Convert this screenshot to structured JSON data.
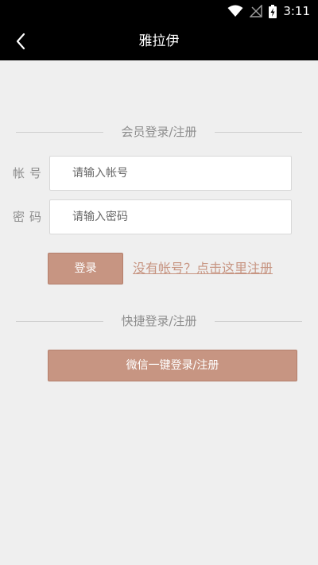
{
  "status_bar": {
    "time": "3:11",
    "icons": [
      "wifi-icon",
      "signal-off-icon",
      "battery-charging-icon"
    ]
  },
  "nav": {
    "title": "雅拉伊",
    "back_icon": "chevron-left-icon"
  },
  "member_section": {
    "title": "会员登录/注册"
  },
  "form": {
    "account_label": "帐号",
    "account_placeholder": "请输入帐号",
    "account_value": "",
    "password_label": "密码",
    "password_placeholder": "请输入密码",
    "password_value": ""
  },
  "actions": {
    "login_label": "登录",
    "register_link": "没有帐号？点击这里注册"
  },
  "quick_section": {
    "title": "快捷登录/注册",
    "wechat_label": "微信一键登录/注册"
  },
  "colors": {
    "accent": "#c79582",
    "background": "#efefef",
    "nav_background": "#000000"
  }
}
